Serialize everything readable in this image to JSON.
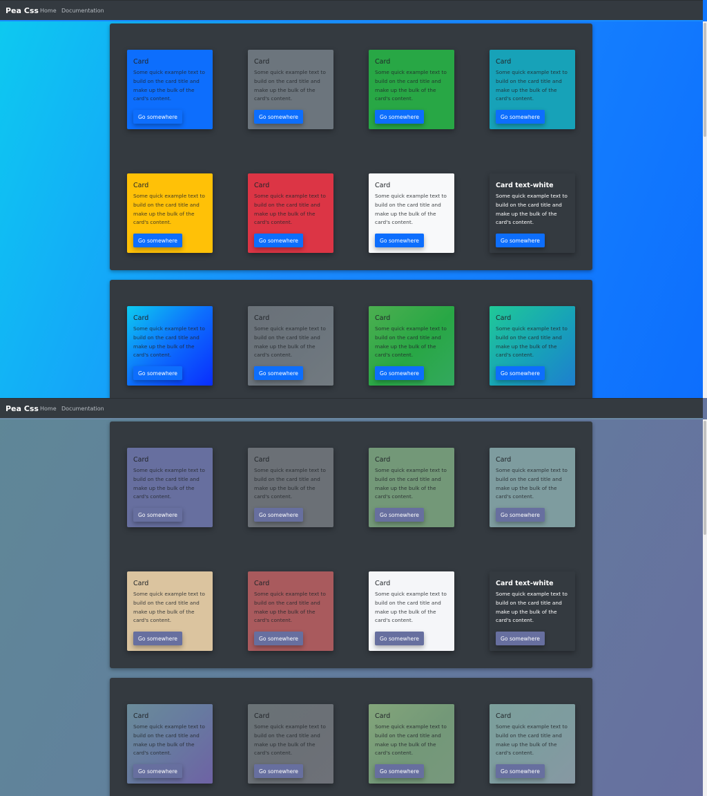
{
  "navbar": {
    "brand": "Pea Css",
    "links": [
      {
        "label": "Home"
      },
      {
        "label": "Documentation"
      }
    ]
  },
  "card": {
    "title": "Card",
    "title_white": "Card text-white",
    "text": "Some quick example text to build on the card title and make up the bulk of the card's content.",
    "button": "Go somewhere"
  },
  "colors": {
    "top_primary": "#0d6efd",
    "top_secondary": "#6c757d",
    "top_success": "#28a745",
    "top_info": "#17a2b8",
    "top_warning": "#ffc107",
    "top_danger": "#dc3545",
    "top_light": "#f8f9fa",
    "top_dark": "#343a40",
    "bottom_primary": "#676f9f",
    "bottom_secondary": "#6b7076",
    "bottom_success": "#739878",
    "bottom_info": "#7e9c9f",
    "bottom_warning": "#dbc49f",
    "bottom_danger": "#a95a5d",
    "bottom_light": "#f5f6f9",
    "bottom_dark": "#343a40"
  }
}
